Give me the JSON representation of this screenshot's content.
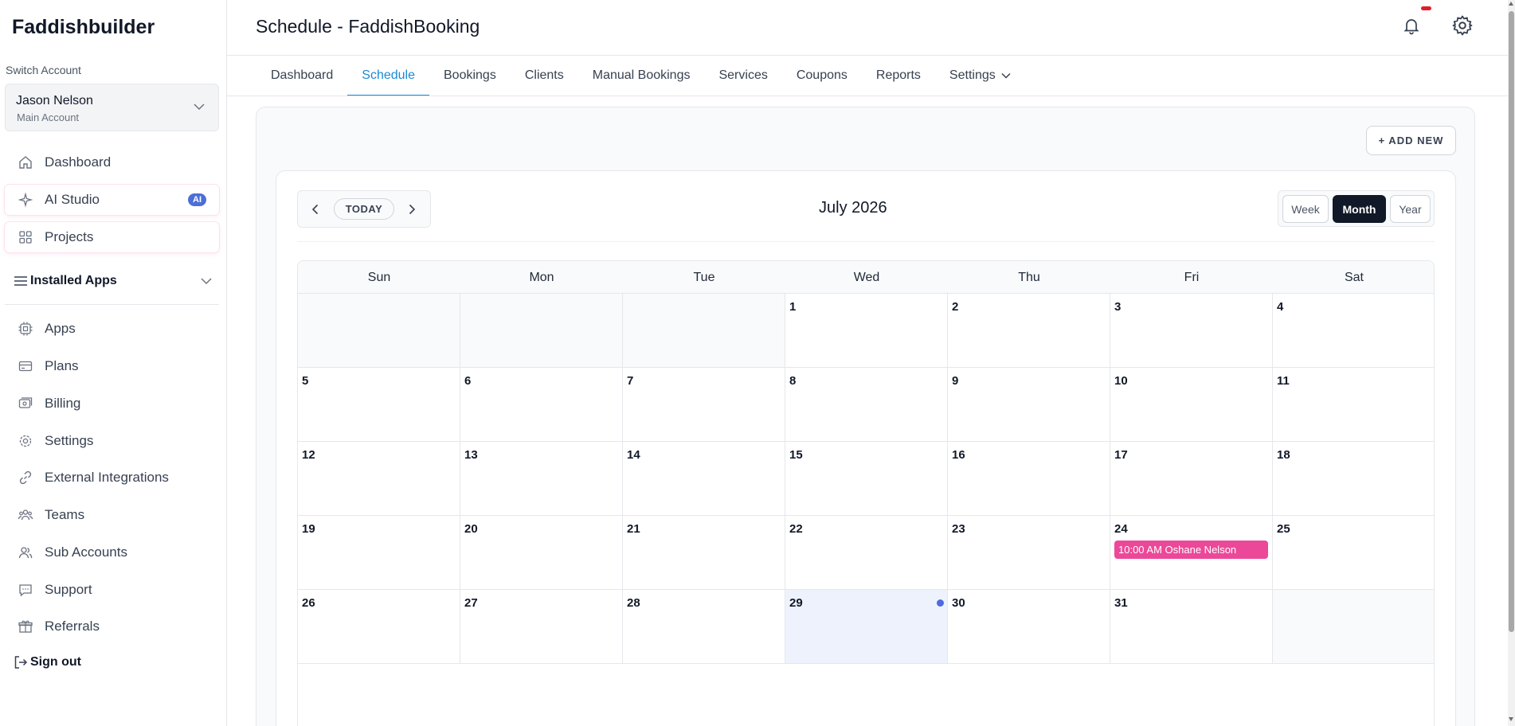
{
  "sidebar": {
    "brand": "Faddishbuilder",
    "switch_label": "Switch Account",
    "account": {
      "name": "Jason Nelson",
      "sub": "Main Account"
    },
    "top_items": [
      {
        "label": "Dashboard",
        "icon": "home-icon"
      },
      {
        "label": "AI Studio",
        "icon": "sparkle-icon",
        "badge": "AI"
      },
      {
        "label": "Projects",
        "icon": "grid-icon"
      }
    ],
    "installed_apps_label": "Installed Apps",
    "items": [
      {
        "label": "Apps",
        "icon": "chip-icon"
      },
      {
        "label": "Plans",
        "icon": "card-icon"
      },
      {
        "label": "Billing",
        "icon": "billing-icon"
      },
      {
        "label": "Settings",
        "icon": "gear-icon"
      },
      {
        "label": "External Integrations",
        "icon": "link-icon"
      },
      {
        "label": "Teams",
        "icon": "team-icon"
      },
      {
        "label": "Sub Accounts",
        "icon": "users-icon"
      },
      {
        "label": "Support",
        "icon": "chat-icon"
      },
      {
        "label": "Referrals",
        "icon": "gift-icon"
      }
    ],
    "signout_label": "Sign out"
  },
  "header": {
    "title": "Schedule - FaddishBooking"
  },
  "tabs": [
    {
      "label": "Dashboard"
    },
    {
      "label": "Schedule",
      "active": true
    },
    {
      "label": "Bookings"
    },
    {
      "label": "Clients"
    },
    {
      "label": "Manual Bookings"
    },
    {
      "label": "Services"
    },
    {
      "label": "Coupons"
    },
    {
      "label": "Reports"
    },
    {
      "label": "Settings",
      "dropdown": true
    }
  ],
  "calendar": {
    "add_new_label": "+ ADD NEW",
    "today_label": "TODAY",
    "month_title": "July 2026",
    "views": [
      "Week",
      "Month",
      "Year"
    ],
    "active_view": "Month",
    "weekdays": [
      "Sun",
      "Mon",
      "Tue",
      "Wed",
      "Thu",
      "Fri",
      "Sat"
    ],
    "weeks": [
      [
        "",
        "",
        "",
        "1",
        "2",
        "3",
        "4"
      ],
      [
        "5",
        "6",
        "7",
        "8",
        "9",
        "10",
        "11"
      ],
      [
        "12",
        "13",
        "14",
        "15",
        "16",
        "17",
        "18"
      ],
      [
        "19",
        "20",
        "21",
        "22",
        "23",
        "24",
        "25"
      ],
      [
        "26",
        "27",
        "28",
        "29",
        "30",
        "31",
        ""
      ]
    ],
    "today": "29",
    "events": [
      {
        "day": "24",
        "label": "10:00 AM Oshane Nelson",
        "color": "#ec4899"
      }
    ]
  },
  "colors": {
    "accent": "#1a8ad4",
    "event": "#ec4899",
    "badge": "#4b6fd6",
    "notification": "#e11d2e",
    "today_bg": "#eef2fd"
  }
}
